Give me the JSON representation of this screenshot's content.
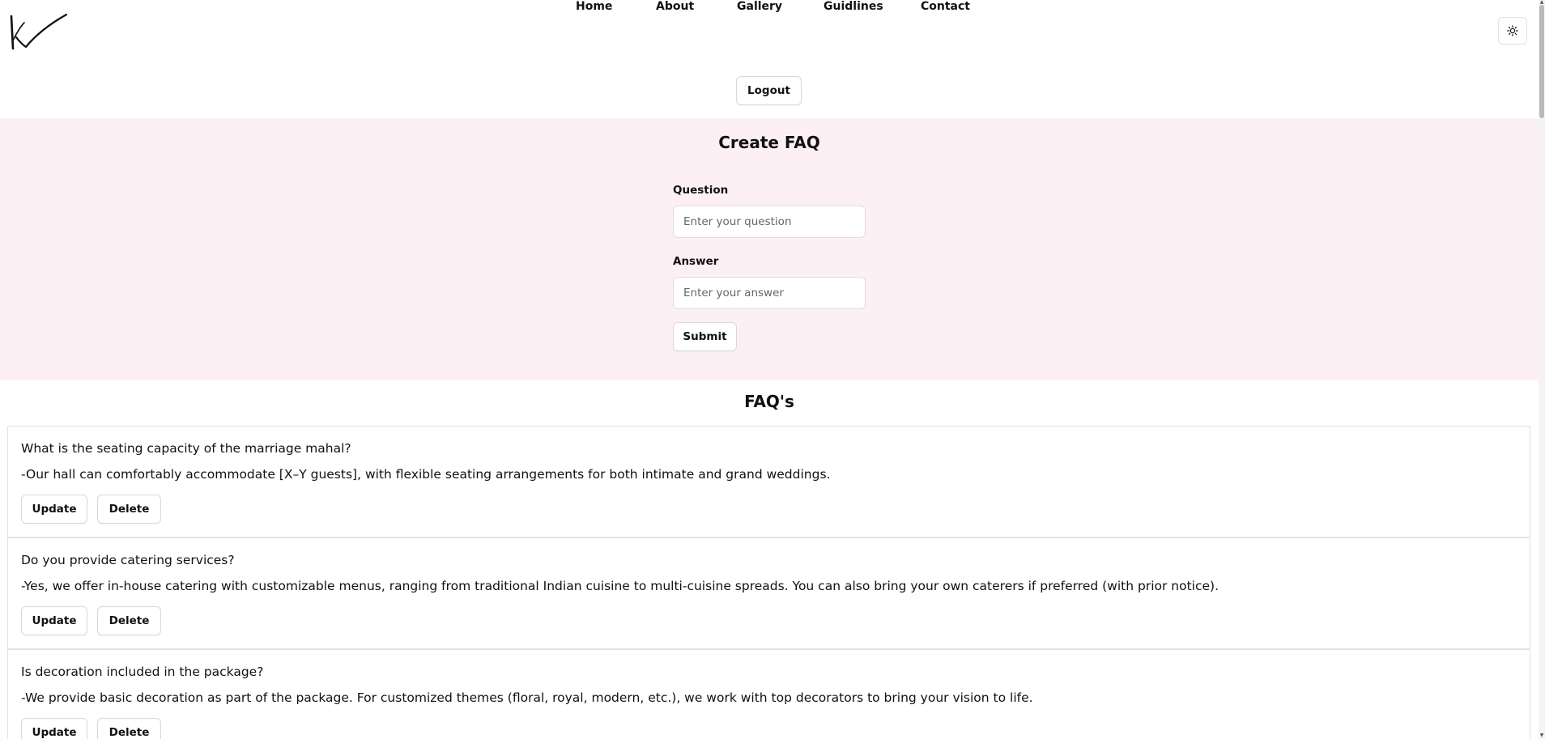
{
  "nav": {
    "links": [
      {
        "label": "Home"
      },
      {
        "label": "About"
      },
      {
        "label": "Gallery"
      },
      {
        "label": "Guidlines"
      },
      {
        "label": "Contact"
      }
    ],
    "theme_icon": "sun-icon",
    "logo_icon": "checkmark-logo-icon"
  },
  "logout_label": "Logout",
  "create": {
    "title": "Create FAQ",
    "question_label": "Question",
    "question_placeholder": "Enter your question",
    "question_value": "",
    "answer_label": "Answer",
    "answer_placeholder": "Enter your answer",
    "answer_value": "",
    "submit_label": "Submit",
    "background": "#fdf0f5"
  },
  "faqs": {
    "title": "FAQ's",
    "update_label": "Update",
    "delete_label": "Delete",
    "items": [
      {
        "question": "What is the seating capacity of the marriage mahal?",
        "answer": "-Our hall can comfortably accommodate [X–Y guests], with flexible seating arrangements for both intimate and grand weddings."
      },
      {
        "question": "Do you provide catering services?",
        "answer": "-Yes, we offer in-house catering with customizable menus, ranging from traditional Indian cuisine to multi-cuisine spreads. You can also bring your own caterers if preferred (with prior notice)."
      },
      {
        "question": "Is decoration included in the package?",
        "answer": "-We provide basic decoration as part of the package. For customized themes (floral, royal, modern, etc.), we work with top decorators to bring your vision to life."
      }
    ]
  }
}
